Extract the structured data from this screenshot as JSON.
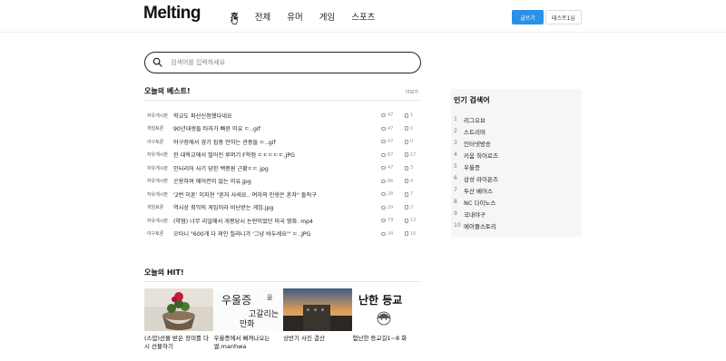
{
  "header": {
    "logo": "Melting",
    "nav": [
      "홈",
      "전체",
      "유머",
      "게임",
      "스포츠"
    ],
    "write_button": "글쓰기",
    "user_button": "테스트1님"
  },
  "search": {
    "placeholder": "검색어를 입력하세요"
  },
  "best": {
    "title": "오늘의 베스트!",
    "more": "더보기",
    "rows": [
      {
        "category": "자유게시판",
        "title": "학교도 파산신청했다네요",
        "comments": "47",
        "likes": "1"
      },
      {
        "category": "게임토론",
        "title": "90년대생들 타자가 빠른 이유 ㄷ..gif",
        "comments": "47",
        "likes": "0"
      },
      {
        "category": "야구토론",
        "title": "야구장에서 경기 집중 안하는 관중들 ㄷ..gif",
        "comments": "47",
        "likes": "0"
      },
      {
        "category": "자유게시판",
        "title": "한 대학교에서 벌어진 루머기 F학점 ㄷㄷㄷㄷㄷ.JPG",
        "comments": "87",
        "likes": "17"
      },
      {
        "category": "자유게시판",
        "title": "인터리어 사기 당한 백종원 근황ㄷㄷ.jpg",
        "comments": "47",
        "likes": "3"
      },
      {
        "category": "자유게시판",
        "title": "곤용하여 에어컨이 없는 이유.jpg",
        "comments": "66",
        "likes": "4"
      },
      {
        "category": "자유게시판",
        "title": "'2번 이혼' 이지현 \"혼자 사세요.. 여자의 인생은 혼자\" 돌직구",
        "comments": "28",
        "likes": "7"
      },
      {
        "category": "게임토론",
        "title": "역시상 최악의 게임이라 비난받는 게임.jpg",
        "comments": "29",
        "likes": "2"
      },
      {
        "category": "자유게시판",
        "title": "(약혐) 너무 리얼해서 개봉당시 논란이었던 미국 영화. mp4",
        "comments": "79",
        "likes": "13"
      },
      {
        "category": "야구토론",
        "title": "오타니 \"600개 다 쳐인 칠라니가 '그냥 바두세요'\" ㄷ..JPG",
        "comments": "34",
        "likes": "10"
      }
    ]
  },
  "hit": {
    "title": "오늘의 HIT!",
    "cards": [
      {
        "title": "(스압)선물 받은 장미를 다시 선물하기",
        "img": "rose"
      },
      {
        "title": "우울증에서 빠져나오는 썰.manhwa",
        "img": "manhwa"
      },
      {
        "title": "상반기 사진 결산",
        "img": "sunset"
      },
      {
        "title": "험난한 등교길1~8 화",
        "img": "comic"
      }
    ]
  },
  "sidebar": {
    "title": "인기 검색어",
    "items": [
      "리그오브",
      "스트리머",
      "인터넷방송",
      "키움 히어로즈",
      "우울증",
      "삼성 라이온즈",
      "두산 베어스",
      "NC 다이노스",
      "국내야구",
      "메이플스토리"
    ]
  },
  "colors": {
    "accent": "#2b90e6"
  }
}
